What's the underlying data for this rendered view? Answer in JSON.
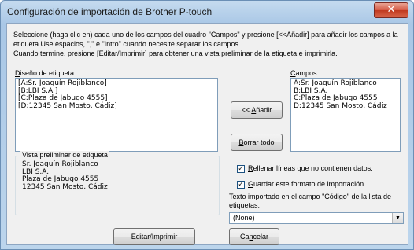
{
  "window": {
    "title": "Configuración de importación de Brother P-touch",
    "close_glyph": "✕"
  },
  "intro": {
    "line1": "Seleccione (haga clic en) cada uno de los campos del cuadro \"Campos\" y presione [<<Añadir] para añadir los campos a la",
    "line2": "etiqueta.Use espacios, \",\" e \"Intro\" cuando necesite separar los campos.",
    "line3": "Cuando termine, presione [Editar/Imprimir] para obtener una vista preliminar de la etiqueta e imprimirla."
  },
  "design": {
    "label_pre": "",
    "label_mn": "D",
    "label_post": "iseño de etiqueta:",
    "lines": [
      "[A:Sr. Joaquín Rojiblanco]",
      "[B:LBI S.A.]",
      "[C:Plaza de Jabugo 4555]",
      "[D:12345 San Mosto, Cádiz]"
    ]
  },
  "fields": {
    "label_pre": "",
    "label_mn": "C",
    "label_post": "ampos:",
    "lines": [
      "A:Sr. Joaquín Rojiblanco",
      "B:LBI S.A.",
      "C:Plaza de Jabugo 4555",
      "D:12345 San Mosto, Cádiz"
    ]
  },
  "buttons": {
    "add_pre": "<< ",
    "add_mn": "A",
    "add_post": "ñadir",
    "clear_pre": "",
    "clear_mn": "B",
    "clear_post": "orrar todo",
    "edit_print": "Editar/Imprimir",
    "cancel_pre": "Ca",
    "cancel_mn": "n",
    "cancel_post": "celar"
  },
  "preview": {
    "title": "Vista preliminar de etiqueta",
    "lines": [
      "Sr. Joaquín Rojiblanco",
      "LBI S.A.",
      "Plaza de Jabugo 4555",
      "12345 San Mosto, Cádiz"
    ]
  },
  "options": {
    "fill_pre": "",
    "fill_mn": "R",
    "fill_post": "ellenar líneas que no contienen datos.",
    "fill_checked": "✓",
    "save_pre": "",
    "save_mn": "G",
    "save_post": "uardar este formato de importación.",
    "save_checked": "✓",
    "text_field_pre": "",
    "text_field_mn": "T",
    "text_field_post": "exto importado en el campo \"Código\" de la lista de",
    "text_field_line2": "etiquetas:",
    "select_value": "(None)",
    "select_arrow": "▼"
  }
}
